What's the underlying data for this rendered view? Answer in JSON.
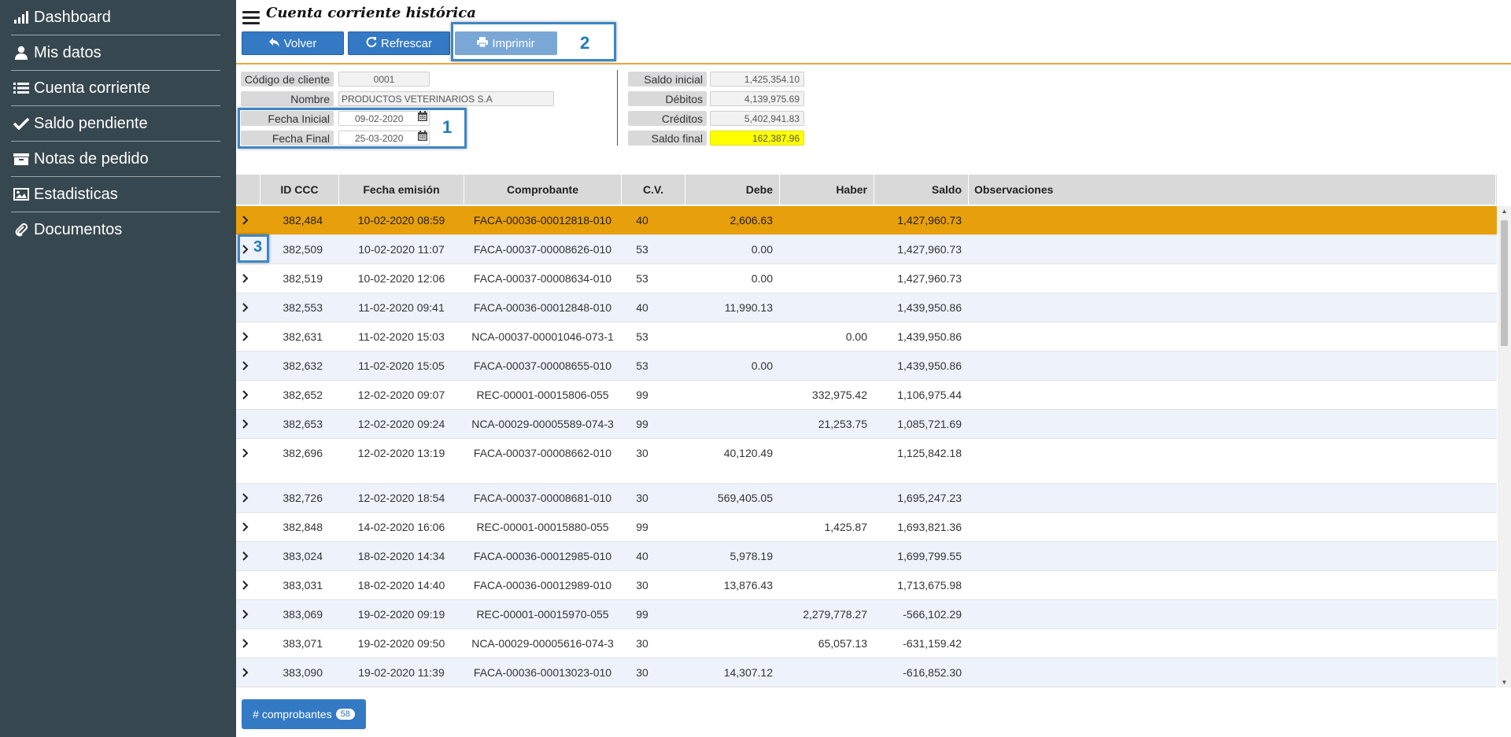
{
  "sidebar": {
    "items": [
      {
        "label": "Dashboard",
        "icon": "signal-bars-icon"
      },
      {
        "label": "Mis datos",
        "icon": "user-icon"
      },
      {
        "label": "Cuenta corriente",
        "icon": "list-icon"
      },
      {
        "label": "Saldo pendiente",
        "icon": "check-icon"
      },
      {
        "label": "Notas de pedido",
        "icon": "archive-icon"
      },
      {
        "label": "Estadisticas",
        "icon": "image-icon"
      },
      {
        "label": "Documentos",
        "icon": "paperclip-icon"
      }
    ]
  },
  "header": {
    "title": "Cuenta corriente histórica",
    "buttons": {
      "volver": "Volver",
      "refrescar": "Refrescar",
      "imprimir": "Imprimir"
    }
  },
  "annotations": {
    "one": "1",
    "two": "2",
    "three": "3"
  },
  "form": {
    "codigo_label": "Código de cliente",
    "codigo_value": "0001",
    "nombre_label": "Nombre",
    "nombre_value": "PRODUCTOS VETERINARIOS S.A",
    "fecha_inicial_label": "Fecha Inicial",
    "fecha_inicial_value": "09-02-2020",
    "fecha_final_label": "Fecha Final",
    "fecha_final_value": "25-03-2020"
  },
  "summary": {
    "saldo_inicial_label": "Saldo inicial",
    "saldo_inicial_value": "1,425,354.10",
    "debitos_label": "Débitos",
    "debitos_value": "4,139,975.69",
    "creditos_label": "Créditos",
    "creditos_value": "5,402,941.83",
    "saldo_final_label": "Saldo final",
    "saldo_final_value": "162,387.96"
  },
  "table": {
    "headers": {
      "id": "ID CCC",
      "fecha": "Fecha emisión",
      "comprobante": "Comprobante",
      "cv": "C.V.",
      "debe": "Debe",
      "haber": "Haber",
      "saldo": "Saldo",
      "obs": "Observaciones"
    },
    "rows": [
      {
        "id": "382,484",
        "fecha": "10-02-2020 08:59",
        "comprobante": "FACA-00036-00012818-010",
        "cv": "40",
        "debe": "2,606.63",
        "haber": "",
        "saldo": "1,427,960.73"
      },
      {
        "id": "382,509",
        "fecha": "10-02-2020 11:07",
        "comprobante": "FACA-00037-00008626-010",
        "cv": "53",
        "debe": "0.00",
        "haber": "",
        "saldo": "1,427,960.73"
      },
      {
        "id": "382,519",
        "fecha": "10-02-2020 12:06",
        "comprobante": "FACA-00037-00008634-010",
        "cv": "53",
        "debe": "0.00",
        "haber": "",
        "saldo": "1,427,960.73"
      },
      {
        "id": "382,553",
        "fecha": "11-02-2020 09:41",
        "comprobante": "FACA-00036-00012848-010",
        "cv": "40",
        "debe": "11,990.13",
        "haber": "",
        "saldo": "1,439,950.86"
      },
      {
        "id": "382,631",
        "fecha": "11-02-2020 15:03",
        "comprobante": "NCA-00037-00001046-073-1",
        "cv": "53",
        "debe": "",
        "haber": "0.00",
        "saldo": "1,439,950.86"
      },
      {
        "id": "382,632",
        "fecha": "11-02-2020 15:05",
        "comprobante": "FACA-00037-00008655-010",
        "cv": "53",
        "debe": "0.00",
        "haber": "",
        "saldo": "1,439,950.86"
      },
      {
        "id": "382,652",
        "fecha": "12-02-2020 09:07",
        "comprobante": "REC-00001-00015806-055",
        "cv": "99",
        "debe": "",
        "haber": "332,975.42",
        "saldo": "1,106,975.44"
      },
      {
        "id": "382,653",
        "fecha": "12-02-2020 09:24",
        "comprobante": "NCA-00029-00005589-074-3",
        "cv": "99",
        "debe": "",
        "haber": "21,253.75",
        "saldo": "1,085,721.69"
      },
      {
        "id": "382,696",
        "fecha": "12-02-2020 13:19",
        "comprobante": "FACA-00037-00008662-010",
        "cv": "30",
        "debe": "40,120.49",
        "haber": "",
        "saldo": "1,125,842.18"
      },
      {
        "id": "382,726",
        "fecha": "12-02-2020 18:54",
        "comprobante": "FACA-00037-00008681-010",
        "cv": "30",
        "debe": "569,405.05",
        "haber": "",
        "saldo": "1,695,247.23"
      },
      {
        "id": "382,848",
        "fecha": "14-02-2020 16:06",
        "comprobante": "REC-00001-00015880-055",
        "cv": "99",
        "debe": "",
        "haber": "1,425.87",
        "saldo": "1,693,821.36"
      },
      {
        "id": "383,024",
        "fecha": "18-02-2020 14:34",
        "comprobante": "FACA-00036-00012985-010",
        "cv": "40",
        "debe": "5,978.19",
        "haber": "",
        "saldo": "1,699,799.55"
      },
      {
        "id": "383,031",
        "fecha": "18-02-2020 14:40",
        "comprobante": "FACA-00036-00012989-010",
        "cv": "30",
        "debe": "13,876.43",
        "haber": "",
        "saldo": "1,713,675.98"
      },
      {
        "id": "383,069",
        "fecha": "19-02-2020 09:19",
        "comprobante": "REC-00001-00015970-055",
        "cv": "99",
        "debe": "",
        "haber": "2,279,778.27",
        "saldo": "-566,102.29"
      },
      {
        "id": "383,071",
        "fecha": "19-02-2020 09:50",
        "comprobante": "NCA-00029-00005616-074-3",
        "cv": "30",
        "debe": "",
        "haber": "65,057.13",
        "saldo": "-631,159.42"
      },
      {
        "id": "383,090",
        "fecha": "19-02-2020 11:39",
        "comprobante": "FACA-00036-00013023-010",
        "cv": "30",
        "debe": "14,307.12",
        "haber": "",
        "saldo": "-616,852.30"
      }
    ]
  },
  "footer": {
    "comprobantes_label": "# comprobantes",
    "comprobantes_count": "58"
  },
  "colors": {
    "sidebar": "#37474f",
    "primary": "#3479c4",
    "selected_row": "#e89f0c",
    "alt_row": "#edf2fb",
    "accent_line": "#e8a63c",
    "highlight": "#ffff00"
  }
}
